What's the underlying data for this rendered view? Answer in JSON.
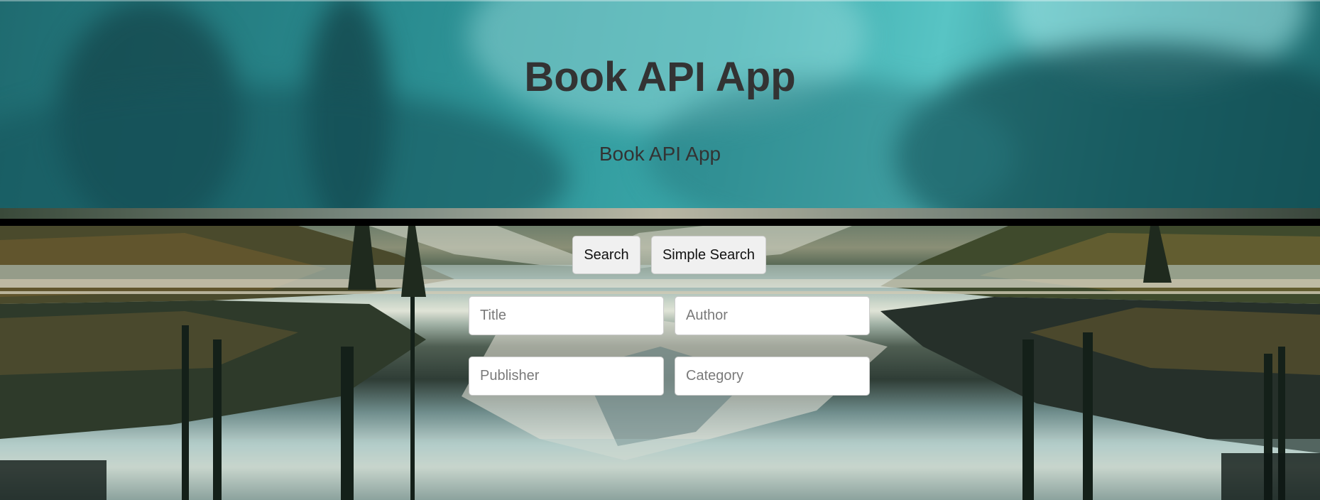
{
  "header": {
    "title": "Book API App",
    "subtitle": "Book API App"
  },
  "actions": {
    "search_label": "Search",
    "simple_search_label": "Simple Search"
  },
  "search_form": {
    "title_placeholder": "Title",
    "author_placeholder": "Author",
    "publisher_placeholder": "Publisher",
    "category_placeholder": "Category"
  },
  "theme": {
    "header_teal": "#2a8c90",
    "heading_text": "#333333",
    "separator": "#000000",
    "button_bg": "#f0f0f0",
    "input_bg": "#ffffff"
  }
}
